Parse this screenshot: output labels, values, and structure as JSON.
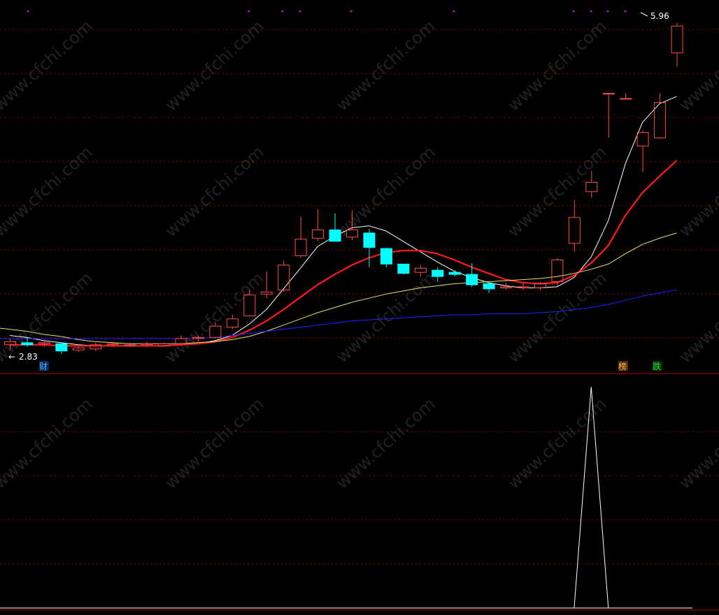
{
  "chart_data": [
    {
      "type": "candlestick",
      "price_labels": {
        "high": "5.96",
        "low": "2.83"
      },
      "markers": [
        "财",
        "榜",
        "跌"
      ],
      "watermark": "www.cfchi.com",
      "candles": [
        {
          "o": 2.85,
          "h": 2.91,
          "l": 2.8,
          "c": 2.88
        },
        {
          "o": 2.87,
          "h": 2.92,
          "l": 2.83,
          "c": 2.85
        },
        {
          "o": 2.86,
          "h": 2.9,
          "l": 2.83,
          "c": 2.87
        },
        {
          "o": 2.86,
          "h": 2.87,
          "l": 2.76,
          "c": 2.79
        },
        {
          "o": 2.8,
          "h": 2.83,
          "l": 2.78,
          "c": 2.82
        },
        {
          "o": 2.81,
          "h": 2.87,
          "l": 2.79,
          "c": 2.85
        },
        {
          "o": 2.85,
          "h": 2.88,
          "l": 2.83,
          "c": 2.86
        },
        {
          "o": 2.84,
          "h": 2.87,
          "l": 2.83,
          "c": 2.85
        },
        {
          "o": 2.85,
          "h": 2.88,
          "l": 2.83,
          "c": 2.86
        },
        {
          "o": 2.84,
          "h": 2.87,
          "l": 2.83,
          "c": 2.86
        },
        {
          "o": 2.86,
          "h": 2.94,
          "l": 2.85,
          "c": 2.91
        },
        {
          "o": 2.91,
          "h": 2.94,
          "l": 2.88,
          "c": 2.92
        },
        {
          "o": 2.92,
          "h": 3.07,
          "l": 2.91,
          "c": 3.03
        },
        {
          "o": 3.02,
          "h": 3.14,
          "l": 3.0,
          "c": 3.1
        },
        {
          "o": 3.13,
          "h": 3.38,
          "l": 3.12,
          "c": 3.33
        },
        {
          "o": 3.34,
          "h": 3.56,
          "l": 3.3,
          "c": 3.36
        },
        {
          "o": 3.38,
          "h": 3.66,
          "l": 3.36,
          "c": 3.62
        },
        {
          "o": 3.71,
          "h": 4.09,
          "l": 3.69,
          "c": 3.87
        },
        {
          "o": 3.88,
          "h": 4.16,
          "l": 3.85,
          "c": 3.96
        },
        {
          "o": 3.96,
          "h": 4.12,
          "l": 3.9,
          "c": 3.85
        },
        {
          "o": 3.89,
          "h": 4.15,
          "l": 3.86,
          "c": 3.96
        },
        {
          "o": 3.93,
          "h": 3.97,
          "l": 3.6,
          "c": 3.79
        },
        {
          "o": 3.78,
          "h": 3.79,
          "l": 3.6,
          "c": 3.63
        },
        {
          "o": 3.63,
          "h": 3.63,
          "l": 3.53,
          "c": 3.54
        },
        {
          "o": 3.55,
          "h": 3.62,
          "l": 3.51,
          "c": 3.59
        },
        {
          "o": 3.57,
          "h": 3.6,
          "l": 3.46,
          "c": 3.51
        },
        {
          "o": 3.55,
          "h": 3.57,
          "l": 3.51,
          "c": 3.53
        },
        {
          "o": 3.53,
          "h": 3.64,
          "l": 3.41,
          "c": 3.43
        },
        {
          "o": 3.44,
          "h": 3.45,
          "l": 3.35,
          "c": 3.39
        },
        {
          "o": 3.4,
          "h": 3.45,
          "l": 3.38,
          "c": 3.41
        },
        {
          "o": 3.4,
          "h": 3.45,
          "l": 3.38,
          "c": 3.41
        },
        {
          "o": 3.4,
          "h": 3.46,
          "l": 3.38,
          "c": 3.44
        },
        {
          "o": 3.46,
          "h": 3.69,
          "l": 3.42,
          "c": 3.67
        },
        {
          "o": 3.83,
          "h": 4.25,
          "l": 3.75,
          "c": 4.08
        },
        {
          "o": 4.33,
          "h": 4.53,
          "l": 4.27,
          "c": 4.42
        },
        {
          "o": 5.28,
          "h": 5.28,
          "l": 4.85,
          "c": 5.28
        },
        {
          "o": 5.23,
          "h": 5.28,
          "l": 5.23,
          "c": 5.23
        },
        {
          "o": 4.77,
          "h": 4.92,
          "l": 4.52,
          "c": 4.9
        },
        {
          "o": 4.85,
          "h": 5.28,
          "l": 4.84,
          "c": 5.19
        },
        {
          "o": 5.67,
          "h": 5.96,
          "l": 5.54,
          "c": 5.93
        }
      ],
      "ma_lines": [
        {
          "color": "#ffffff",
          "width": 1,
          "values": [
            2.94,
            2.92,
            2.89,
            2.87,
            2.85,
            2.84,
            2.84,
            2.84,
            2.84,
            2.84,
            2.85,
            2.86,
            2.89,
            2.94,
            3.05,
            3.19,
            3.39,
            3.59,
            3.8,
            3.9,
            3.98,
            4.0,
            3.95,
            3.85,
            3.75,
            3.65,
            3.56,
            3.5,
            3.45,
            3.42,
            3.4,
            3.4,
            3.41,
            3.5,
            3.7,
            4.05,
            4.6,
            5.0,
            5.18,
            5.25
          ]
        },
        {
          "color": "#ff1a1a",
          "width": 2.2,
          "values": [
            2.85,
            2.85,
            2.85,
            2.84,
            2.84,
            2.84,
            2.84,
            2.84,
            2.84,
            2.84,
            2.85,
            2.86,
            2.88,
            2.92,
            2.99,
            3.08,
            3.19,
            3.31,
            3.43,
            3.53,
            3.62,
            3.69,
            3.74,
            3.76,
            3.76,
            3.73,
            3.67,
            3.6,
            3.54,
            3.48,
            3.45,
            3.44,
            3.45,
            3.52,
            3.64,
            3.81,
            4.1,
            4.32,
            4.48,
            4.63
          ]
        },
        {
          "color": "#e8e26a",
          "width": 1,
          "values": [
            3.0,
            2.98,
            2.95,
            2.93,
            2.9,
            2.88,
            2.87,
            2.86,
            2.86,
            2.86,
            2.86,
            2.87,
            2.88,
            2.9,
            2.93,
            2.98,
            3.04,
            3.1,
            3.16,
            3.21,
            3.26,
            3.3,
            3.34,
            3.37,
            3.4,
            3.42,
            3.44,
            3.45,
            3.46,
            3.47,
            3.48,
            3.49,
            3.51,
            3.54,
            3.58,
            3.63,
            3.73,
            3.82,
            3.88,
            3.93
          ]
        },
        {
          "color": "#2222ff",
          "width": 1,
          "values": [
            2.91,
            2.91,
            2.91,
            2.91,
            2.91,
            2.91,
            2.91,
            2.91,
            2.91,
            2.91,
            2.91,
            2.91,
            2.92,
            2.94,
            2.96,
            2.98,
            3.0,
            3.02,
            3.04,
            3.06,
            3.08,
            3.09,
            3.1,
            3.11,
            3.12,
            3.13,
            3.14,
            3.14,
            3.15,
            3.15,
            3.15,
            3.16,
            3.17,
            3.19,
            3.21,
            3.24,
            3.28,
            3.32,
            3.35,
            3.38
          ]
        }
      ],
      "ylim": [
        2.72,
        6.06
      ]
    },
    {
      "type": "line",
      "color": "#ffffff",
      "values": [
        0,
        0,
        0,
        0,
        0,
        0,
        0,
        0,
        0,
        0,
        0,
        0,
        0,
        0,
        0,
        0,
        0,
        0,
        0,
        0,
        0,
        0,
        0,
        0,
        0,
        0,
        0,
        0,
        0,
        0,
        0,
        0,
        0,
        0,
        1,
        0,
        0,
        0,
        0,
        0
      ],
      "ylim": [
        0,
        1
      ]
    }
  ],
  "colors": {
    "up": "#ff4a4a",
    "down": "#00ffff",
    "grid": "#8a0000",
    "axis": "#b00000",
    "text": "#ffffff",
    "marker_cai": "#5ab0ff",
    "marker_bang": "#ffb060",
    "marker_die": "#30dd30",
    "dots": "#ff00ff"
  }
}
